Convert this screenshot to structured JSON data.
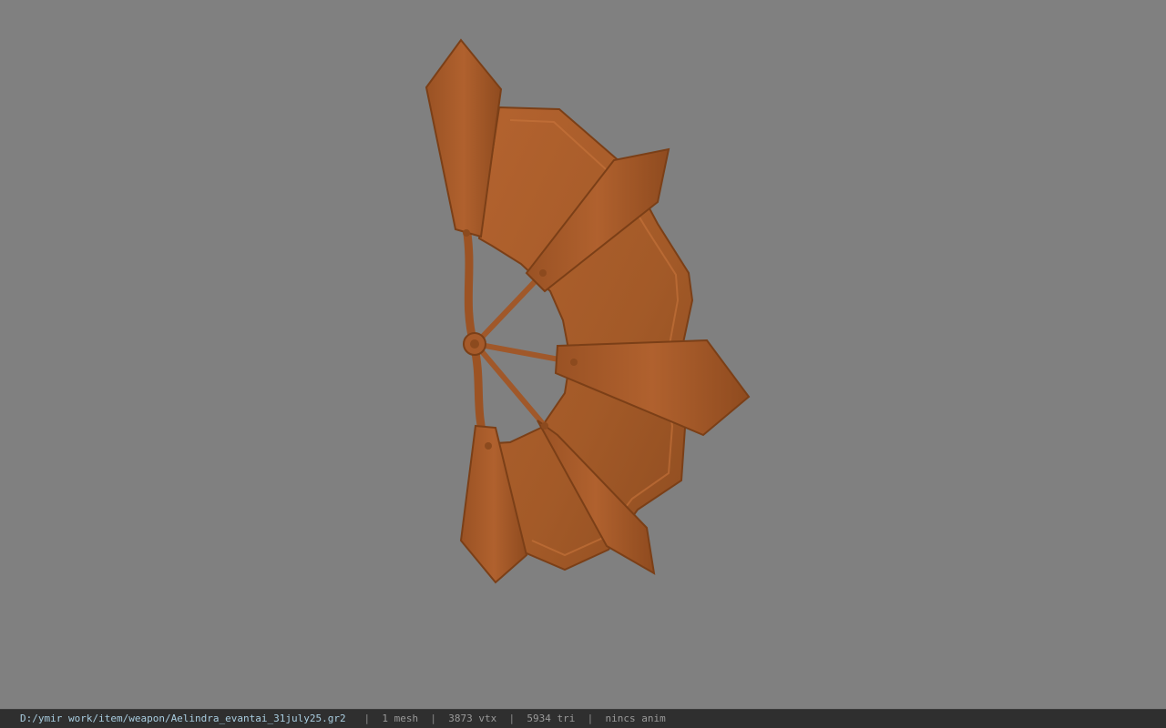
{
  "viewport": {
    "background_color": "#808080",
    "model": {
      "name": "fan-weapon-model",
      "material_color": "#a65a2a"
    }
  },
  "status_bar": {
    "file_path": "D:/ymir work/item/weapon/Aelindra_evantai_31july25.gr2",
    "separator": "|",
    "mesh_count": "1 mesh",
    "vertex_count": "3873 vtx",
    "triangle_count": "5934 tri",
    "anim_status": "nincs anim"
  }
}
